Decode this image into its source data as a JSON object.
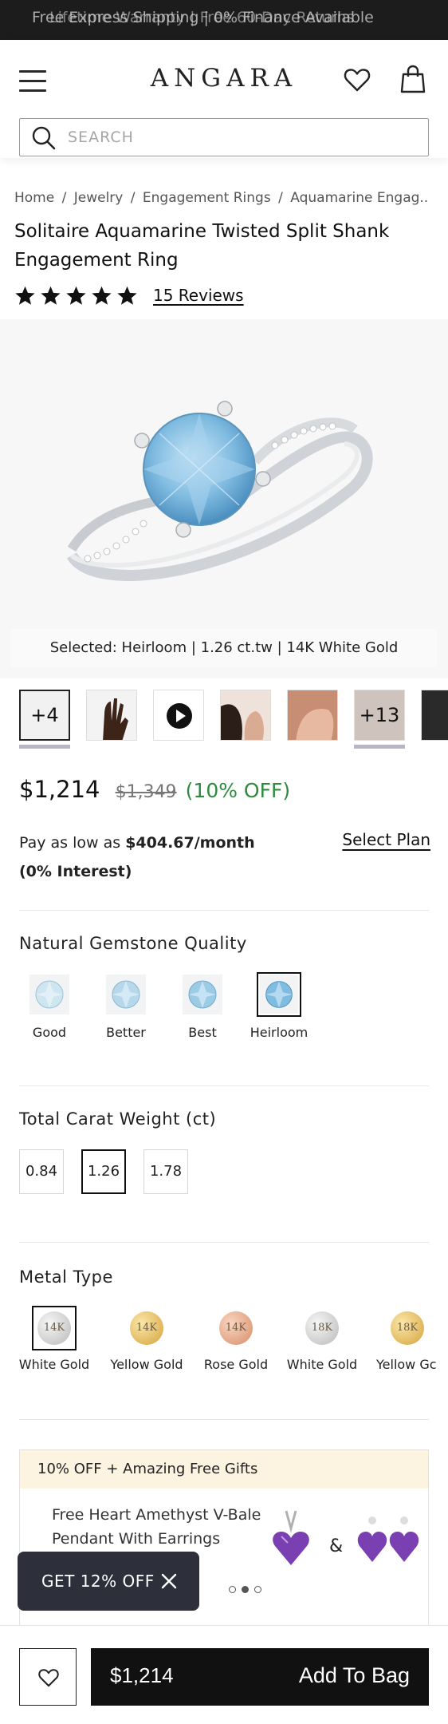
{
  "announcement": {
    "text_1": "Free Express Shipping | 0% Finance Available",
    "text_2": "Lifetime Warranty | Free 60-Day Returns"
  },
  "header": {
    "logo": "ANGARA",
    "search_placeholder": "SEARCH"
  },
  "breadcrumb": [
    "Home",
    "/",
    "Jewelry",
    "/",
    "Engagement Rings",
    "/",
    "Aquamarine Engag..."
  ],
  "product": {
    "title": "Solitaire Aquamarine Twisted Split Shank Engagement Ring",
    "rating": 5,
    "reviews": "15 Reviews",
    "selected": "Selected: Heirloom | 1.26 ct.tw | 14K White Gold"
  },
  "thumbnails": {
    "first_overlay": "+4",
    "last_overlay": "+13"
  },
  "pricing": {
    "price": "$1,214",
    "old_price": "$1,349",
    "discount": "(10% OFF)",
    "pay_prefix": "Pay as low as",
    "pay_amount": "$404.67/month",
    "pay_note": "(0% Interest)",
    "select_plan": "Select Plan"
  },
  "quality": {
    "title": "Natural Gemstone Quality",
    "options": [
      "Good",
      "Better",
      "Best",
      "Heirloom"
    ],
    "selected": "Heirloom"
  },
  "carat": {
    "title": "Total Carat Weight (ct)",
    "options": [
      "0.84",
      "1.26",
      "1.78"
    ],
    "selected": "1.26"
  },
  "metal": {
    "title": "Metal Type",
    "options": [
      {
        "karat": "14K",
        "label": "White Gold"
      },
      {
        "karat": "14K",
        "label": "Yellow Gold"
      },
      {
        "karat": "14K",
        "label": "Rose Gold"
      },
      {
        "karat": "18K",
        "label": "White Gold"
      },
      {
        "karat": "18K",
        "label": "Yellow Gc"
      }
    ]
  },
  "promo": {
    "header": "10% OFF + Amazing Free Gifts",
    "gift_text": "Free Heart Amethyst V-Bale Pendant With Earrings",
    "amp": "&"
  },
  "coupon": {
    "label": "GET 12% OFF"
  },
  "bottom": {
    "price": "$1,214",
    "cta": "Add To Bag"
  },
  "colors": {
    "accent_green": "#2e8b3e",
    "dark": "#111111",
    "promo_bg": "#fcf4e1",
    "coupon_bg": "#2d2f3a"
  }
}
